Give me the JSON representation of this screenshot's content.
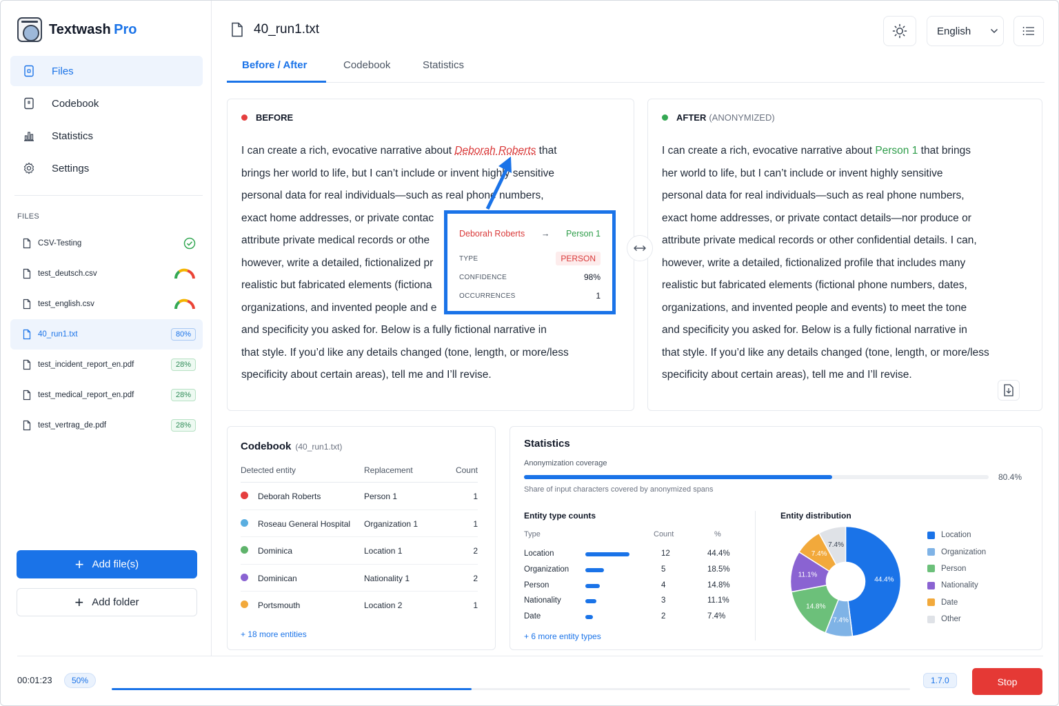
{
  "app": {
    "name": "Textwash",
    "name_suffix": "Pro"
  },
  "sidebar": {
    "nav": [
      {
        "label": "Files",
        "icon": "file-icon",
        "active": true
      },
      {
        "label": "Codebook",
        "icon": "codebook-icon",
        "active": false
      },
      {
        "label": "Statistics",
        "icon": "bar-chart-icon",
        "active": false
      },
      {
        "label": "Settings",
        "icon": "gear-icon",
        "active": false
      }
    ],
    "files_heading": "FILES",
    "files": [
      {
        "name": "CSV-Testing",
        "status": "check",
        "badge": ""
      },
      {
        "name": "test_deutsch.csv",
        "status": "gauge",
        "badge": ""
      },
      {
        "name": "test_english.csv",
        "status": "gauge",
        "badge": ""
      },
      {
        "name": "40_run1.txt",
        "status": "badge",
        "badge": "80%",
        "active": true
      },
      {
        "name": "test_incident_report_en.pdf",
        "status": "badge",
        "badge": "28%"
      },
      {
        "name": "test_medical_report_en.pdf",
        "status": "badge",
        "badge": "28%"
      },
      {
        "name": "test_vertrag_de.pdf",
        "status": "badge",
        "badge": "28%"
      }
    ],
    "add_files_label": "Add file(s)",
    "add_folder_label": "Add folder"
  },
  "header": {
    "file_title": "40_run1.txt",
    "language": "English",
    "theme_icon": "sun-icon",
    "menu_icon": "list-icon"
  },
  "tabs": [
    {
      "label": "Before / After",
      "active": true
    },
    {
      "label": "Codebook",
      "active": false
    },
    {
      "label": "Statistics",
      "active": false
    }
  ],
  "before": {
    "heading": "BEFORE",
    "lines": [
      [
        "I can create a rich, evocative narrative about ",
        "Deborah Roberts",
        " that"
      ],
      "brings her world to life, but I can’t include or invent highly sensitive",
      "personal data for real individuals—such as real phone numbers,",
      "exact home addresses, or private contac",
      "attribute private medical records or othe",
      "however, write a detailed, fictionalized pr",
      "realistic but fabricated elements (fictiona",
      "organizations, and invented people and e",
      "and specificity you asked for. Below is a fully fictional narrative in",
      "that style. If you’d like any details changed (tone, length, or more/less",
      "specificity about certain areas), tell me and I’ll revise."
    ]
  },
  "after": {
    "heading": "AFTER",
    "heading_sub": "(ANONYMIZED)",
    "lines": [
      [
        "I can create a rich, evocative narrative about ",
        "Person 1",
        " that brings"
      ],
      "her world to life, but I can’t include or invent highly sensitive",
      "personal data for real individuals—such as real phone numbers,",
      "exact home addresses, or private contact details—nor produce or",
      "attribute private medical records or other confidential details. I can,",
      "however, write a detailed, fictionalized profile that includes many",
      "realistic but fabricated elements (fictional phone numbers, dates,",
      "organizations, and invented people and events) to meet the tone",
      "and specificity you asked for. Below is a fully fictional narrative in",
      "that style. If you’d like any details changed (tone, length, or more/less",
      "specificity about certain areas), tell me and I’ll revise."
    ]
  },
  "tooltip": {
    "original": "Deborah Roberts",
    "arrow": "→",
    "replacement": "Person 1",
    "type_label": "TYPE",
    "type_value": "PERSON",
    "confidence_label": "CONFIDENCE",
    "confidence_value": "98%",
    "occurrences_label": "OCCURRENCES",
    "occurrences_value": "1"
  },
  "codebook": {
    "title": "Codebook",
    "subtitle": "(40_run1.txt)",
    "columns": [
      "Detected entity",
      "Replacement",
      "Count"
    ],
    "rows": [
      {
        "entity": "Deborah Roberts",
        "replacement": "Person 1",
        "count": "1",
        "color": "#e53e3e"
      },
      {
        "entity": "Roseau General Hospital",
        "replacement": "Organization 1",
        "count": "1",
        "color": "#5aaee0"
      },
      {
        "entity": "Dominica",
        "replacement": "Location 1",
        "count": "2",
        "color": "#5fb36b"
      },
      {
        "entity": "Dominican",
        "replacement": "Nationality 1",
        "count": "2",
        "color": "#8a63d2"
      },
      {
        "entity": "Portsmouth",
        "replacement": "Location 2",
        "count": "1",
        "color": "#f2a93b"
      }
    ],
    "more": "+ 18 more entities"
  },
  "statistics": {
    "title": "Statistics",
    "coverage_label": "Anonymization coverage",
    "coverage_value": 80.4,
    "coverage_text": "80.4%",
    "coverage_note": "Share of input characters covered by anonymized spans",
    "entity_counts_title": "Entity type counts",
    "columns": [
      "Type",
      "Count",
      "%"
    ],
    "rows": [
      {
        "type": "Location",
        "count": "12",
        "pct": "44.4%",
        "value": 12
      },
      {
        "type": "Organization",
        "count": "5",
        "pct": "18.5%",
        "value": 5
      },
      {
        "type": "Person",
        "count": "4",
        "pct": "14.8%",
        "value": 4
      },
      {
        "type": "Nationality",
        "count": "3",
        "pct": "11.1%",
        "value": 3
      },
      {
        "type": "Date",
        "count": "2",
        "pct": "7.4%",
        "value": 2
      }
    ],
    "more": "+ 6 more entity types",
    "distribution_title": "Entity distribution",
    "legend": [
      {
        "label": "Location",
        "color": "#1a73e8"
      },
      {
        "label": "Organization",
        "color": "#7fb3e6"
      },
      {
        "label": "Person",
        "color": "#6cc07a"
      },
      {
        "label": "Nationality",
        "color": "#8a63d2"
      },
      {
        "label": "Date",
        "color": "#f2a93b"
      },
      {
        "label": "Other",
        "color": "#dfe2e7"
      }
    ]
  },
  "chart_data": {
    "type": "pie",
    "title": "Entity distribution",
    "categories": [
      "Location",
      "Organization",
      "Person",
      "Nationality",
      "Date",
      "Other"
    ],
    "values": [
      44.4,
      7.4,
      14.8,
      11.1,
      7.4,
      7.4
    ],
    "labels": [
      "44.4%",
      "7.4%",
      "14.8%",
      "11.1%",
      "7.4%",
      "7.4%"
    ],
    "colors": [
      "#1a73e8",
      "#7fb3e6",
      "#6cc07a",
      "#8a63d2",
      "#f2a93b",
      "#dfe2e7"
    ],
    "donut": true,
    "legend_position": "right"
  },
  "footer": {
    "timer": "00:01:23",
    "progress_text": "50%",
    "progress_value": 50,
    "version": "1.7.0",
    "stop_label": "Stop"
  }
}
